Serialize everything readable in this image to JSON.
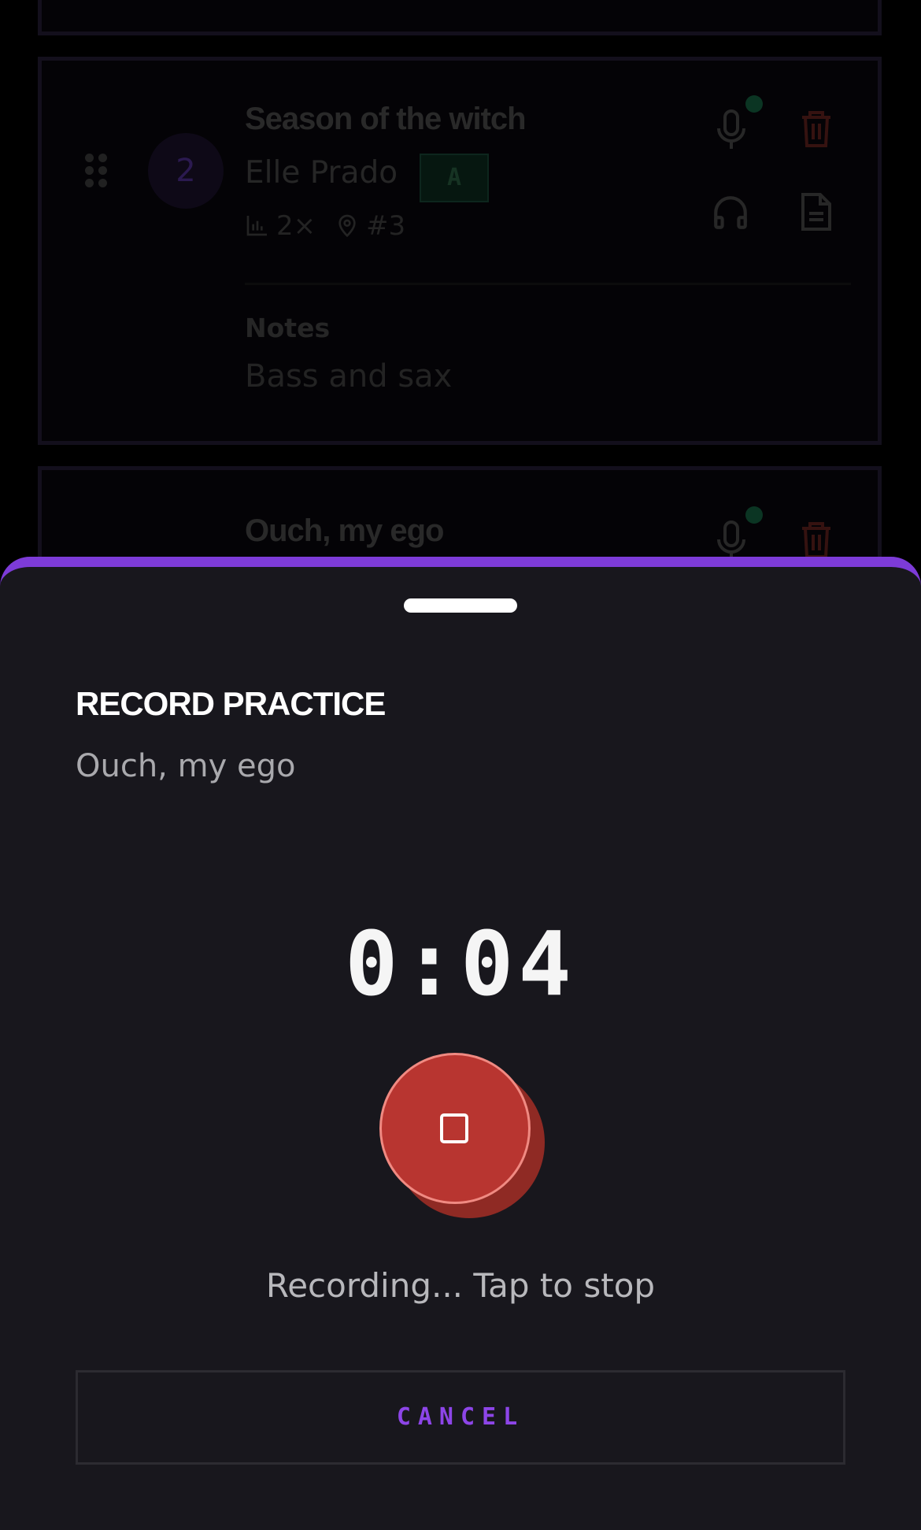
{
  "setlist": {
    "songs": [
      {
        "number": "2",
        "title": "Season of the witch",
        "artist": "Elle Prado",
        "key": "A",
        "practice_count": "2×",
        "position": "#3",
        "notes_label": "Notes",
        "notes": "Bass and sax"
      },
      {
        "title": "Ouch, my ego"
      }
    ]
  },
  "sheet": {
    "title": "RECORD PRACTICE",
    "song": "Ouch, my ego",
    "timer": "0:04",
    "status": "Recording... Tap to stop",
    "cancel_label": "CANCEL"
  },
  "colors": {
    "accent": "#7d3bd8",
    "record": "#b83530",
    "sheet_bg": "#18171d",
    "delete": "#3a1412"
  }
}
